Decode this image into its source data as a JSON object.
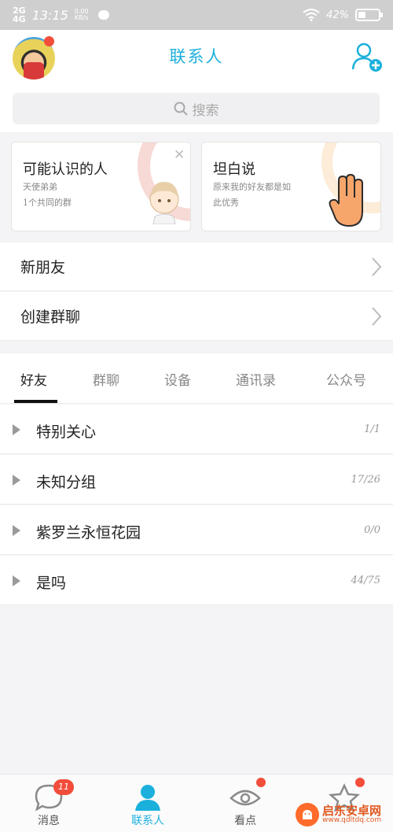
{
  "status_bar": {
    "signal": "2G",
    "signal2": "4G",
    "time": "13:15",
    "speed_value": "0.00",
    "speed_unit": "KB/s",
    "battery": "42%"
  },
  "header": {
    "title": "联系人",
    "search_placeholder": "搜索"
  },
  "cards": [
    {
      "title": "可能认识的人",
      "subtitle_1": "天使弟弟",
      "subtitle_2": "1个共同的群"
    },
    {
      "title": "坦白说",
      "subtitle_1": "原来我的好友都是如",
      "subtitle_2": "此优秀"
    }
  ],
  "menu": {
    "new_friends": "新朋友",
    "create_group": "创建群聊"
  },
  "tabs": [
    "好友",
    "群聊",
    "设备",
    "通讯录",
    "公众号"
  ],
  "groups": [
    {
      "name": "特别关心",
      "count": "1/1"
    },
    {
      "name": "未知分组",
      "count": "17/26"
    },
    {
      "name": "紫罗兰永恒花园",
      "count": "0/0"
    },
    {
      "name": "是吗",
      "count": "44/75"
    }
  ],
  "tabbar": {
    "messages_label": "消息",
    "messages_badge": "11",
    "contacts_label": "联系人",
    "watch_label": "看点"
  },
  "watermark": {
    "title": "启东安卓网",
    "url": "www.qdltdq.com"
  },
  "colors": {
    "accent": "#1bb0dc",
    "badge": "#f24d3a"
  }
}
